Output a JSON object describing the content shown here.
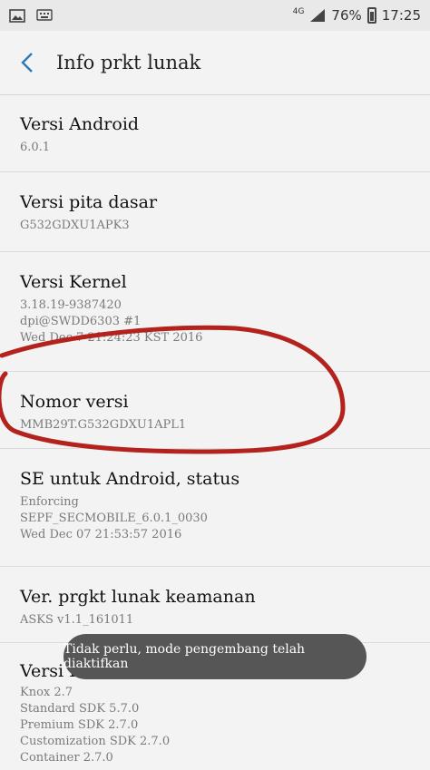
{
  "status_bar": {
    "network": "4G",
    "battery": "76%",
    "time": "17:25"
  },
  "header": {
    "title": "Info prkt lunak"
  },
  "items": [
    {
      "title": "Versi Android",
      "lines": [
        "6.0.1"
      ]
    },
    {
      "title": "Versi pita dasar",
      "lines": [
        "G532GDXU1APK3"
      ]
    },
    {
      "title": "Versi Kernel",
      "lines": [
        "3.18.19-9387420",
        "dpi@SWDD6303 #1",
        "Wed Dec 7 21:24:23 KST 2016"
      ]
    },
    {
      "title": "Nomor versi",
      "lines": [
        "MMB29T.G532GDXU1APL1"
      ]
    },
    {
      "title": "SE untuk Android, status",
      "lines": [
        "Enforcing",
        "SEPF_SECMOBILE_6.0.1_0030",
        "Wed Dec 07 21:53:57 2016"
      ]
    },
    {
      "title": "Ver. prgkt lunak keamanan",
      "lines": [
        "ASKS v1.1_161011"
      ]
    },
    {
      "title": "Versi Knox",
      "lines": [
        "Knox 2.7",
        "Standard SDK 5.7.0",
        "Premium SDK 2.7.0",
        "Customization SDK 2.7.0",
        "Container 2.7.0"
      ]
    }
  ],
  "toast": {
    "text": "Tidak perlu, mode pengembang telah diaktifkan"
  },
  "colors": {
    "annotation": "#b3221c",
    "toast_bg": "#565656",
    "background": "#f3f3f3"
  }
}
